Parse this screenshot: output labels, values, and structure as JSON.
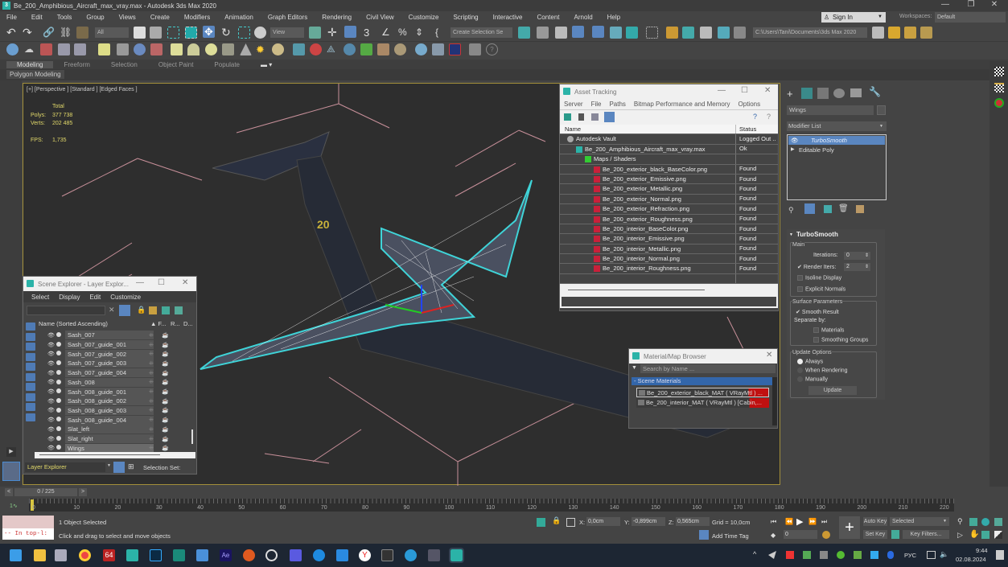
{
  "window": {
    "title": "Be_200_Amphibious_Aircraft_max_vray.max - Autodesk 3ds Max 2020",
    "minimize": "—",
    "restore": "❐",
    "close": "✕"
  },
  "menubar": {
    "items": [
      "File",
      "Edit",
      "Tools",
      "Group",
      "Views",
      "Create",
      "Modifiers",
      "Animation",
      "Graph Editors",
      "Rendering",
      "Civil View",
      "Customize",
      "Scripting",
      "Interactive",
      "Content",
      "Arnold",
      "Help"
    ],
    "sign_in": "Sign In",
    "workspaces_label": "Workspaces:",
    "workspaces_value": "Default"
  },
  "toolbar": {
    "selection_filter": "All",
    "reference_coord": "View",
    "named_selection": "Create Selection Se",
    "project_path": "C:\\Users\\Tani\\Documents\\3ds Max 2020"
  },
  "ribbon": {
    "tabs": [
      "Modeling",
      "Freeform",
      "Selection",
      "Object Paint",
      "Populate"
    ],
    "active_tab": "Modeling",
    "sub_label": "Polygon Modeling"
  },
  "viewport": {
    "label": "[+] [Perspective ] [Standard ] [Edged Faces ]",
    "stats_header": "Total",
    "polys_label": "Polys:",
    "polys_value": "377 738",
    "verts_label": "Verts:",
    "verts_value": "202 485",
    "fps_label": "FPS:",
    "fps_value": "1,735"
  },
  "asset_tracking": {
    "title": "Asset Tracking",
    "menu": [
      "Server",
      "File",
      "Paths",
      "Bitmap Performance and Memory",
      "Options"
    ],
    "columns": [
      "Name",
      "Status"
    ],
    "rows": [
      {
        "name": "Autodesk Vault",
        "status": "Logged Out ..",
        "indent": 1,
        "icon": "vault-icon"
      },
      {
        "name": "Be_200_Amphibious_Aircraft_max_vray.max",
        "status": "Ok",
        "indent": 2,
        "icon": "max-file-icon"
      },
      {
        "name": "Maps / Shaders",
        "status": "",
        "indent": 3,
        "icon": "maps-icon"
      },
      {
        "name": "Be_200_exterior_black_BaseColor.png",
        "status": "Found",
        "indent": 4,
        "icon": "png-icon"
      },
      {
        "name": "Be_200_exterior_Emissive.png",
        "status": "Found",
        "indent": 4,
        "icon": "png-icon"
      },
      {
        "name": "Be_200_exterior_Metallic.png",
        "status": "Found",
        "indent": 4,
        "icon": "png-icon"
      },
      {
        "name": "Be_200_exterior_Normal.png",
        "status": "Found",
        "indent": 4,
        "icon": "png-icon"
      },
      {
        "name": "Be_200_exterior_Refraction.png",
        "status": "Found",
        "indent": 4,
        "icon": "png-icon"
      },
      {
        "name": "Be_200_exterior_Roughness.png",
        "status": "Found",
        "indent": 4,
        "icon": "png-icon"
      },
      {
        "name": "Be_200_interior_BaseColor.png",
        "status": "Found",
        "indent": 4,
        "icon": "png-icon"
      },
      {
        "name": "Be_200_interior_Emissive.png",
        "status": "Found",
        "indent": 4,
        "icon": "png-icon"
      },
      {
        "name": "Be_200_interior_Metallic.png",
        "status": "Found",
        "indent": 4,
        "icon": "png-icon"
      },
      {
        "name": "Be_200_interior_Normal.png",
        "status": "Found",
        "indent": 4,
        "icon": "png-icon"
      },
      {
        "name": "Be_200_interior_Roughness.png",
        "status": "Found",
        "indent": 4,
        "icon": "png-icon"
      }
    ]
  },
  "scene_explorer": {
    "title": "Scene Explorer - Layer Explor...",
    "menu": [
      "Select",
      "Display",
      "Edit",
      "Customize"
    ],
    "column_name": "Name (Sorted Ascending)",
    "column_f": "▲ F...",
    "column_r": "R...",
    "column_d": "D...",
    "items": [
      "Sash_007",
      "Sash_007_guide_001",
      "Sash_007_guide_002",
      "Sash_007_guide_003",
      "Sash_007_guide_004",
      "Sash_008",
      "Sash_008_guide_001",
      "Sash_008_guide_002",
      "Sash_008_guide_003",
      "Sash_008_guide_004",
      "Slat_left",
      "Slat_right",
      "Wings"
    ],
    "selected_item": "Wings",
    "footer_dropdown": "Layer Explorer",
    "footer_label": "Selection Set:"
  },
  "material_browser": {
    "title": "Material/Map Browser",
    "search_placeholder": "Search by Name ...",
    "group": "- Scene Materials",
    "materials": [
      "Be_200_exterior_black_MAT  ( VRayMtl ) ...",
      "Be_200_interior_MAT  ( VRayMtl ) [Cabin,..."
    ]
  },
  "command_panel": {
    "object_name": "Wings",
    "modifier_list": "Modifier List",
    "stack": [
      {
        "name": "TurboSmooth",
        "selected": true
      },
      {
        "name": "Editable Poly",
        "selected": false
      }
    ],
    "rollout_title": "TurboSmooth",
    "main_group": "Main",
    "iterations_label": "Iterations:",
    "iterations_value": "0",
    "render_iters_label": "Render Iters:",
    "render_iters_value": "2",
    "render_iters_checked": true,
    "isoline_label": "Isoline Display",
    "explicit_normals_label": "Explicit Normals",
    "surface_group": "Surface Parameters",
    "smooth_result_label": "Smooth Result",
    "separate_by_label": "Separate by:",
    "materials_label": "Materials",
    "smoothing_groups_label": "Smoothing Groups",
    "update_group": "Update Options",
    "always_label": "Always",
    "when_rendering_label": "When Rendering",
    "manually_label": "Manually",
    "update_button": "Update"
  },
  "timeline": {
    "frame_counter": "0 / 225",
    "prev": "<",
    "next": ">",
    "ticks": [
      "0",
      "10",
      "20",
      "30",
      "40",
      "50",
      "60",
      "70",
      "80",
      "90",
      "100",
      "110",
      "120",
      "130",
      "140",
      "150",
      "160",
      "170",
      "180",
      "190",
      "200",
      "210",
      "220"
    ]
  },
  "status": {
    "maxscript_line": "-- In top-l:",
    "selected": "1 Object Selected",
    "prompt": "Click and drag to select and move objects",
    "x_label": "X:",
    "x_value": "0,0cm",
    "y_label": "Y:",
    "y_value": "-0,899cm",
    "z_label": "Z:",
    "z_value": "0,565cm",
    "grid": "Grid = 10,0cm",
    "add_time_tag": "Add Time Tag",
    "current_frame": "0",
    "auto_key": "Auto Key",
    "set_key": "Set Key",
    "key_mode": "Selected",
    "key_filters": "Key Filters..."
  },
  "taskbar": {
    "lang": "РУС",
    "time": "9:44",
    "date": "02.08.2024"
  }
}
